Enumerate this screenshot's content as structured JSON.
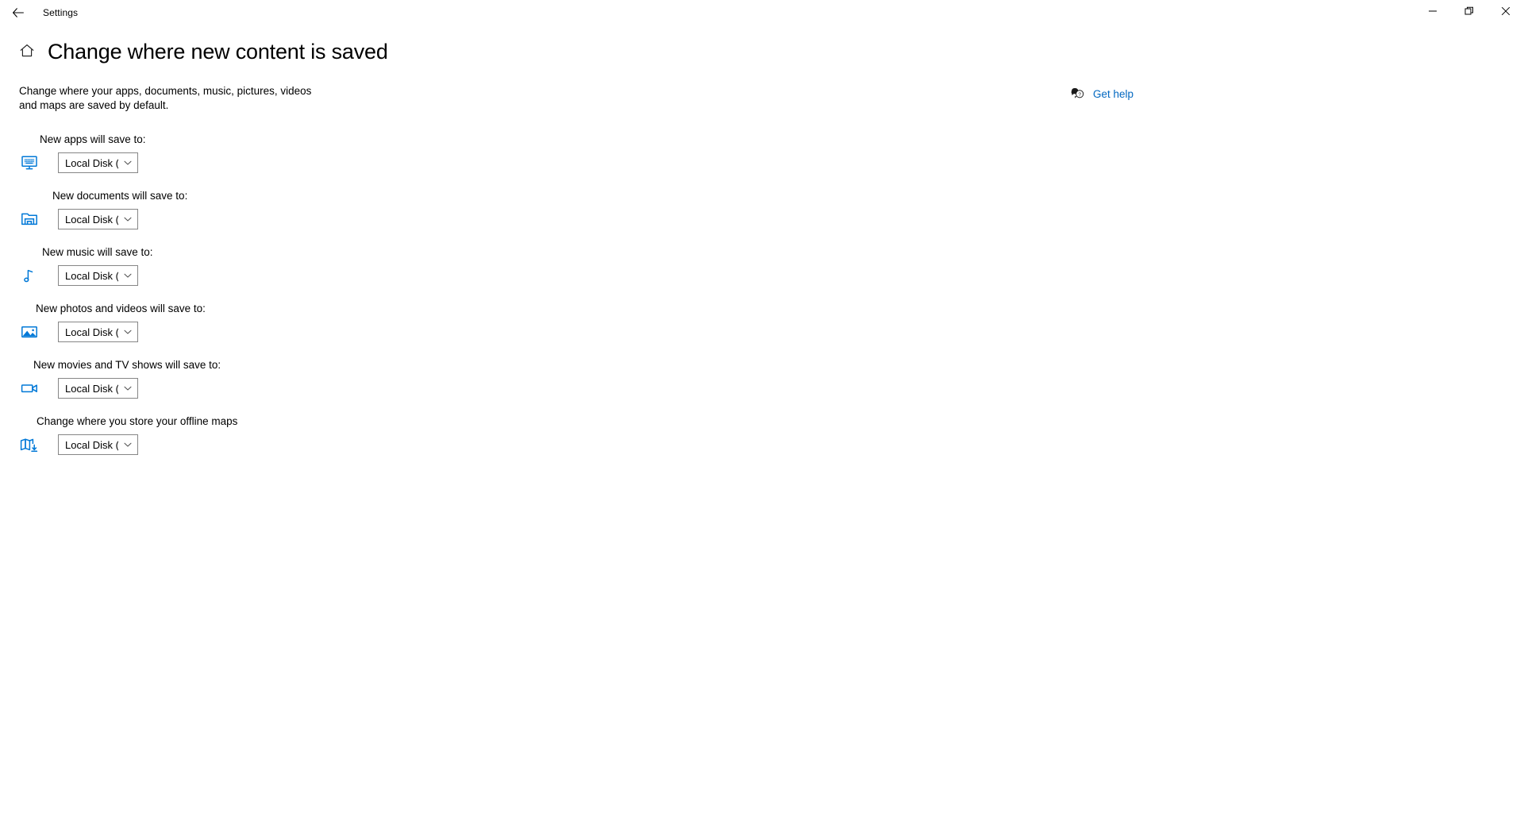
{
  "window": {
    "app_title": "Settings",
    "back_icon": "back-arrow-icon",
    "minimize_label": "Minimize",
    "restore_label": "Restore",
    "close_label": "Close"
  },
  "header": {
    "home_icon": "home-icon",
    "title": "Change where new content is saved"
  },
  "intro": {
    "text": "Change where your apps, documents, music, pictures, videos and maps are saved by default."
  },
  "help": {
    "icon": "question-bubble-icon",
    "label": "Get help",
    "color": "#0067c0"
  },
  "accent_color": "#0078d7",
  "rows": [
    {
      "key": "apps",
      "icon": "apps-monitor-icon",
      "label": "New apps will save to:",
      "value": "Local Disk (C:)",
      "options": [
        "Local Disk (C:)"
      ]
    },
    {
      "key": "docs",
      "icon": "documents-folder-icon",
      "label": "New documents will save to:",
      "value": "Local Disk (C:)",
      "options": [
        "Local Disk (C:)"
      ]
    },
    {
      "key": "music",
      "icon": "music-note-icon",
      "label": "New music will save to:",
      "value": "Local Disk (C:)",
      "options": [
        "Local Disk (C:)"
      ]
    },
    {
      "key": "photos",
      "icon": "photo-picture-icon",
      "label": "New photos and videos will save to:",
      "value": "Local Disk (C:)",
      "options": [
        "Local Disk (C:)"
      ]
    },
    {
      "key": "movies",
      "icon": "video-camera-icon",
      "label": "New movies and TV shows will save to:",
      "value": "Local Disk (C:)",
      "options": [
        "Local Disk (C:)"
      ]
    },
    {
      "key": "maps",
      "icon": "offline-maps-icon",
      "label": "Change where you store your offline maps",
      "value": "Local Disk (C:)",
      "options": [
        "Local Disk (C:)"
      ]
    }
  ]
}
